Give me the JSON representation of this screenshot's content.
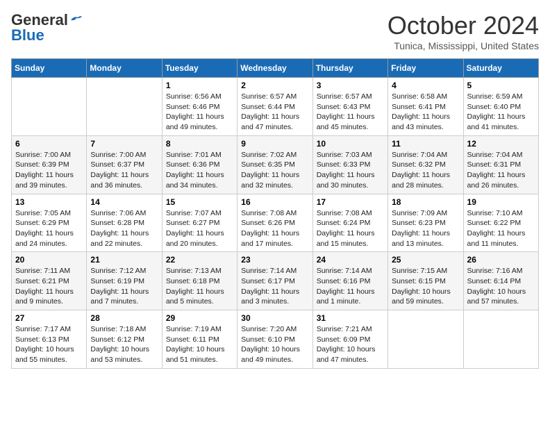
{
  "header": {
    "logo_general": "General",
    "logo_blue": "Blue",
    "month_title": "October 2024",
    "location": "Tunica, Mississippi, United States"
  },
  "days_of_week": [
    "Sunday",
    "Monday",
    "Tuesday",
    "Wednesday",
    "Thursday",
    "Friday",
    "Saturday"
  ],
  "weeks": [
    [
      {
        "day": "",
        "info": ""
      },
      {
        "day": "",
        "info": ""
      },
      {
        "day": "1",
        "info": "Sunrise: 6:56 AM\nSunset: 6:46 PM\nDaylight: 11 hours and 49 minutes."
      },
      {
        "day": "2",
        "info": "Sunrise: 6:57 AM\nSunset: 6:44 PM\nDaylight: 11 hours and 47 minutes."
      },
      {
        "day": "3",
        "info": "Sunrise: 6:57 AM\nSunset: 6:43 PM\nDaylight: 11 hours and 45 minutes."
      },
      {
        "day": "4",
        "info": "Sunrise: 6:58 AM\nSunset: 6:41 PM\nDaylight: 11 hours and 43 minutes."
      },
      {
        "day": "5",
        "info": "Sunrise: 6:59 AM\nSunset: 6:40 PM\nDaylight: 11 hours and 41 minutes."
      }
    ],
    [
      {
        "day": "6",
        "info": "Sunrise: 7:00 AM\nSunset: 6:39 PM\nDaylight: 11 hours and 39 minutes."
      },
      {
        "day": "7",
        "info": "Sunrise: 7:00 AM\nSunset: 6:37 PM\nDaylight: 11 hours and 36 minutes."
      },
      {
        "day": "8",
        "info": "Sunrise: 7:01 AM\nSunset: 6:36 PM\nDaylight: 11 hours and 34 minutes."
      },
      {
        "day": "9",
        "info": "Sunrise: 7:02 AM\nSunset: 6:35 PM\nDaylight: 11 hours and 32 minutes."
      },
      {
        "day": "10",
        "info": "Sunrise: 7:03 AM\nSunset: 6:33 PM\nDaylight: 11 hours and 30 minutes."
      },
      {
        "day": "11",
        "info": "Sunrise: 7:04 AM\nSunset: 6:32 PM\nDaylight: 11 hours and 28 minutes."
      },
      {
        "day": "12",
        "info": "Sunrise: 7:04 AM\nSunset: 6:31 PM\nDaylight: 11 hours and 26 minutes."
      }
    ],
    [
      {
        "day": "13",
        "info": "Sunrise: 7:05 AM\nSunset: 6:29 PM\nDaylight: 11 hours and 24 minutes."
      },
      {
        "day": "14",
        "info": "Sunrise: 7:06 AM\nSunset: 6:28 PM\nDaylight: 11 hours and 22 minutes."
      },
      {
        "day": "15",
        "info": "Sunrise: 7:07 AM\nSunset: 6:27 PM\nDaylight: 11 hours and 20 minutes."
      },
      {
        "day": "16",
        "info": "Sunrise: 7:08 AM\nSunset: 6:26 PM\nDaylight: 11 hours and 17 minutes."
      },
      {
        "day": "17",
        "info": "Sunrise: 7:08 AM\nSunset: 6:24 PM\nDaylight: 11 hours and 15 minutes."
      },
      {
        "day": "18",
        "info": "Sunrise: 7:09 AM\nSunset: 6:23 PM\nDaylight: 11 hours and 13 minutes."
      },
      {
        "day": "19",
        "info": "Sunrise: 7:10 AM\nSunset: 6:22 PM\nDaylight: 11 hours and 11 minutes."
      }
    ],
    [
      {
        "day": "20",
        "info": "Sunrise: 7:11 AM\nSunset: 6:21 PM\nDaylight: 11 hours and 9 minutes."
      },
      {
        "day": "21",
        "info": "Sunrise: 7:12 AM\nSunset: 6:19 PM\nDaylight: 11 hours and 7 minutes."
      },
      {
        "day": "22",
        "info": "Sunrise: 7:13 AM\nSunset: 6:18 PM\nDaylight: 11 hours and 5 minutes."
      },
      {
        "day": "23",
        "info": "Sunrise: 7:14 AM\nSunset: 6:17 PM\nDaylight: 11 hours and 3 minutes."
      },
      {
        "day": "24",
        "info": "Sunrise: 7:14 AM\nSunset: 6:16 PM\nDaylight: 11 hours and 1 minute."
      },
      {
        "day": "25",
        "info": "Sunrise: 7:15 AM\nSunset: 6:15 PM\nDaylight: 10 hours and 59 minutes."
      },
      {
        "day": "26",
        "info": "Sunrise: 7:16 AM\nSunset: 6:14 PM\nDaylight: 10 hours and 57 minutes."
      }
    ],
    [
      {
        "day": "27",
        "info": "Sunrise: 7:17 AM\nSunset: 6:13 PM\nDaylight: 10 hours and 55 minutes."
      },
      {
        "day": "28",
        "info": "Sunrise: 7:18 AM\nSunset: 6:12 PM\nDaylight: 10 hours and 53 minutes."
      },
      {
        "day": "29",
        "info": "Sunrise: 7:19 AM\nSunset: 6:11 PM\nDaylight: 10 hours and 51 minutes."
      },
      {
        "day": "30",
        "info": "Sunrise: 7:20 AM\nSunset: 6:10 PM\nDaylight: 10 hours and 49 minutes."
      },
      {
        "day": "31",
        "info": "Sunrise: 7:21 AM\nSunset: 6:09 PM\nDaylight: 10 hours and 47 minutes."
      },
      {
        "day": "",
        "info": ""
      },
      {
        "day": "",
        "info": ""
      }
    ]
  ]
}
